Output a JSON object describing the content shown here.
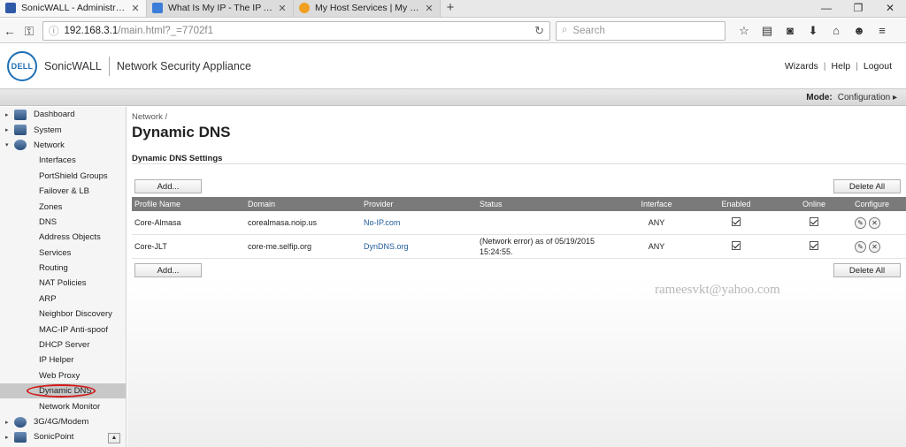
{
  "browser": {
    "tabs": [
      {
        "title": "SonicWALL - Administrati…",
        "active": true,
        "favicon_color": "#2e5aa8"
      },
      {
        "title": "What Is My IP - The IP Ad…",
        "active": false,
        "favicon_color": "#3b7dd8"
      },
      {
        "title": "My Host Services | My Dy…",
        "active": false,
        "favicon_color": "#f0a020"
      }
    ],
    "new_tab": "+",
    "window_controls": [
      "—",
      "❐",
      "✕"
    ],
    "url_host": "192.168.3.1",
    "url_path": "/main.html?_=7702f1",
    "search_placeholder": "Search"
  },
  "header": {
    "logo_text": "DELL",
    "brand": "SonicWALL",
    "app_name": "Network Security Appliance",
    "links": [
      "Wizards",
      "Help",
      "Logout"
    ],
    "mode_label": "Mode:",
    "mode_value": "Configuration ▸"
  },
  "sidebar": {
    "top_items": [
      {
        "label": "Dashboard",
        "tri": "▸"
      },
      {
        "label": "System",
        "tri": "▸"
      },
      {
        "label": "Network",
        "tri": "▾"
      }
    ],
    "network_items": [
      "Interfaces",
      "PortShield Groups",
      "Failover & LB",
      "Zones",
      "DNS",
      "Address Objects",
      "Services",
      "Routing",
      "NAT Policies",
      "ARP",
      "Neighbor Discovery",
      "MAC-IP Anti-spoof",
      "DHCP Server",
      "IP Helper",
      "Web Proxy",
      "Dynamic DNS",
      "Network Monitor"
    ],
    "selected": "Dynamic DNS",
    "bottom_items": [
      {
        "label": "3G/4G/Modem",
        "tri": "▸"
      },
      {
        "label": "SonicPoint",
        "tri": "▸"
      }
    ]
  },
  "main": {
    "breadcrumb": "Network /",
    "title": "Dynamic DNS",
    "section_title": "Dynamic DNS Settings",
    "add_label": "Add...",
    "delete_all_label": "Delete All",
    "columns": [
      "Profile Name",
      "Domain",
      "Provider",
      "Status",
      "Interface",
      "Enabled",
      "Online",
      "Configure"
    ],
    "rows": [
      {
        "profile": "Core-Almasa",
        "domain": "corealmasa.noip.us",
        "provider": "No-IP.com",
        "status": "",
        "interface": "ANY",
        "enabled": true,
        "online": true
      },
      {
        "profile": "Core-JLT",
        "domain": "core-me.selfip.org",
        "provider": "DynDNS.org",
        "status": "(Network error) as of 05/19/2015 15:24:55.",
        "interface": "ANY",
        "enabled": true,
        "online": true
      }
    ]
  },
  "watermark": "rameesvkt@yahoo.com"
}
